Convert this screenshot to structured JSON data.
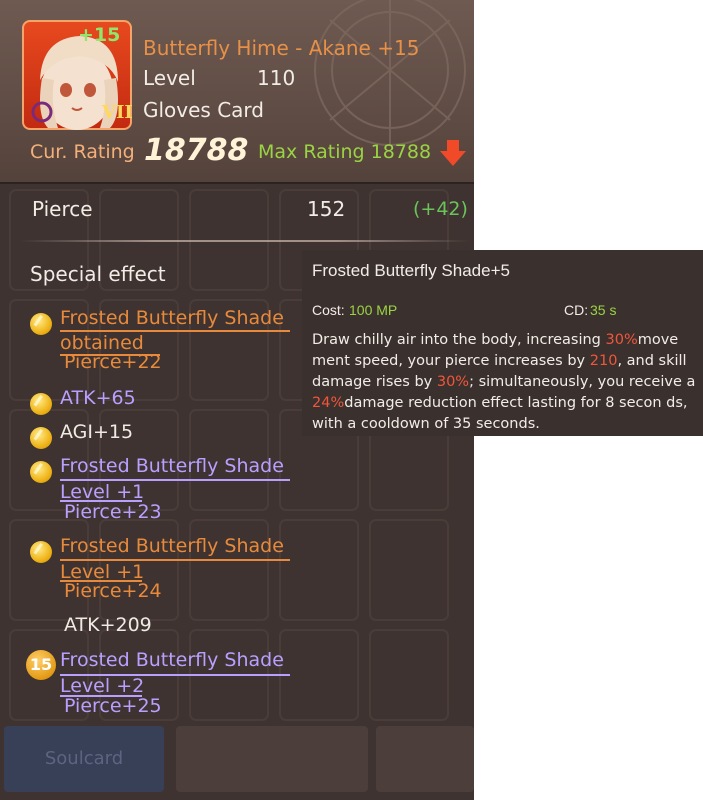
{
  "card": {
    "name": "Butterfly Hime - Akane +15",
    "level_label": "Level",
    "level_value": "110",
    "type": "Gloves Card",
    "portrait_plus": "+15",
    "portrait_rank": "VII",
    "cur_rating_label": "Cur. Rating",
    "cur_rating_value": "18788",
    "max_rating_label": "Max Rating 18788"
  },
  "stat": {
    "name": "Pierce",
    "value": "152",
    "bonus": "(+42)"
  },
  "special": {
    "title": "Special effect",
    "effects": [
      {
        "title": "Frosted Butterfly Shade",
        "sub": "obtained",
        "detail": "Pierce+22",
        "style": "orange"
      },
      {
        "title": "ATK+65",
        "style": "purple"
      },
      {
        "title": "AGI+15",
        "style": "white"
      },
      {
        "title": "Frosted Butterfly Shade",
        "sub": "Level +1",
        "detail": "Pierce+23",
        "style": "purple"
      },
      {
        "title": "Frosted Butterfly Shade",
        "sub": "Level +1",
        "detail": "Pierce+24",
        "style": "orange"
      },
      {
        "title": "ATK+209",
        "style": "white"
      },
      {
        "title": "Frosted Butterfly Shade",
        "sub": "Level +2",
        "detail": "Pierce+25",
        "style": "purple",
        "badge": "15"
      }
    ]
  },
  "buttons": [
    {
      "label": "Soulcard"
    },
    {
      "label": ""
    },
    {
      "label": ""
    }
  ],
  "tooltip": {
    "title": "Frosted Butterfly Shade+5",
    "cost_label": "Cost:",
    "cost_value": "100 MP",
    "cd_label": "CD:",
    "cd_value": "35 s",
    "desc": [
      "Draw chilly air into the body, increasing ",
      "30%",
      "move ment speed, your pierce increases by ",
      "210",
      ", and skill damage rises by ",
      "30%",
      "; simultaneously, you receive a ",
      "24%",
      "damage reduction effect lasting for 8 secon ds, with a cooldown of 35 seconds."
    ]
  },
  "colors": {
    "panel_bg": "#3e3330",
    "header_bg": "#6e5a51",
    "name_orange": "#e69048",
    "max_rating_green": "#9ad343",
    "highlight_red": "#f0563a",
    "effect_purple": "#b9a0ff"
  },
  "icons": [
    "red-down-arrow-icon",
    "gold-coin-icon",
    "rank-15-badge-icon"
  ]
}
